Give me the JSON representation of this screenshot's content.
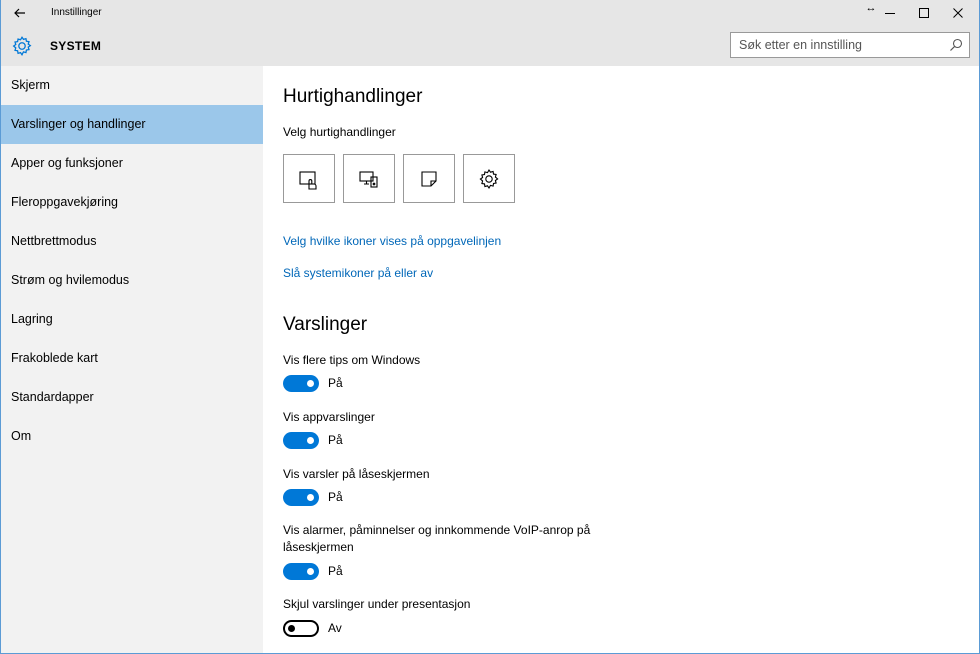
{
  "window": {
    "title": "Innstillinger"
  },
  "header": {
    "section_title": "SYSTEM",
    "search_placeholder": "Søk etter en innstilling"
  },
  "sidebar": {
    "items": [
      {
        "label": "Skjerm",
        "active": false
      },
      {
        "label": "Varslinger og handlinger",
        "active": true
      },
      {
        "label": "Apper og funksjoner",
        "active": false
      },
      {
        "label": "Fleroppgavekjøring",
        "active": false
      },
      {
        "label": "Nettbrettmodus",
        "active": false
      },
      {
        "label": "Strøm og hvilemodus",
        "active": false
      },
      {
        "label": "Lagring",
        "active": false
      },
      {
        "label": "Frakoblede kart",
        "active": false
      },
      {
        "label": "Standardapper",
        "active": false
      },
      {
        "label": "Om",
        "active": false
      }
    ]
  },
  "quick_actions": {
    "heading": "Hurtighandlinger",
    "subheading": "Velg hurtighandlinger",
    "buttons": [
      "tablet-mode-icon",
      "connect-display-icon",
      "note-icon",
      "settings-gear-icon"
    ],
    "link_taskbar_icons": "Velg hvilke ikoner vises på oppgavelinjen",
    "link_system_icons": "Slå systemikoner på eller av"
  },
  "notifications": {
    "heading": "Varslinger",
    "settings": [
      {
        "label": "Vis flere tips om Windows",
        "state": "På",
        "on": true
      },
      {
        "label": "Vis appvarslinger",
        "state": "På",
        "on": true
      },
      {
        "label": "Vis varsler på låseskjermen",
        "state": "På",
        "on": true
      },
      {
        "label": "Vis alarmer, påminnelser og innkommende VoIP-anrop på låseskjermen",
        "state": "På",
        "on": true
      },
      {
        "label": "Skjul varslinger under presentasjon",
        "state": "Av",
        "on": false
      }
    ]
  },
  "colors": {
    "accent": "#0078d7",
    "link": "#0067b8",
    "sidebar_active": "#9bc7ea",
    "titlebar": "#e6e6e6"
  }
}
